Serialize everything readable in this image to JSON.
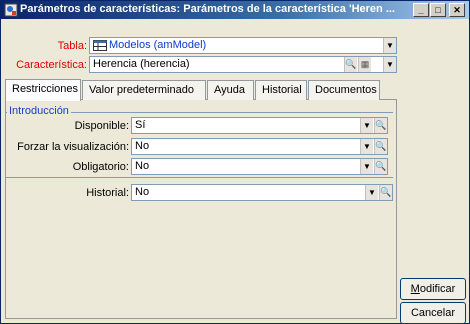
{
  "window": {
    "title": "Parámetros de características: Parámetros de la característica 'Heren ...",
    "app_icon": "asset-manager-icon",
    "controls": {
      "minimize": "_",
      "maximize": "□",
      "close": "✕"
    }
  },
  "header": {
    "tabla_label": "Tabla:",
    "tabla_value": "Modelos (amModel)",
    "tabla_icon": "table-icon",
    "caracteristica_label": "Característica:",
    "caracteristica_value": "Herencia (herencia)"
  },
  "tabs": [
    {
      "label": "Restricciones",
      "active": true
    },
    {
      "label": "Valor predeterminado",
      "active": false
    },
    {
      "label": "Ayuda",
      "active": false
    },
    {
      "label": "Historial",
      "active": false
    },
    {
      "label": "Documentos",
      "active": false
    }
  ],
  "introduccion": {
    "title": "Introducción",
    "fields": [
      {
        "label": "Disponible:",
        "value": "Sí"
      },
      {
        "label": "Forzar la visualización:",
        "value": "No"
      },
      {
        "label": "Obligatorio:",
        "value": "No"
      }
    ]
  },
  "historial": {
    "label": "Historial:",
    "value": "No"
  },
  "buttons": {
    "modify_prefix": "M",
    "modify_rest": "odificar",
    "cancel": "Cancelar"
  }
}
